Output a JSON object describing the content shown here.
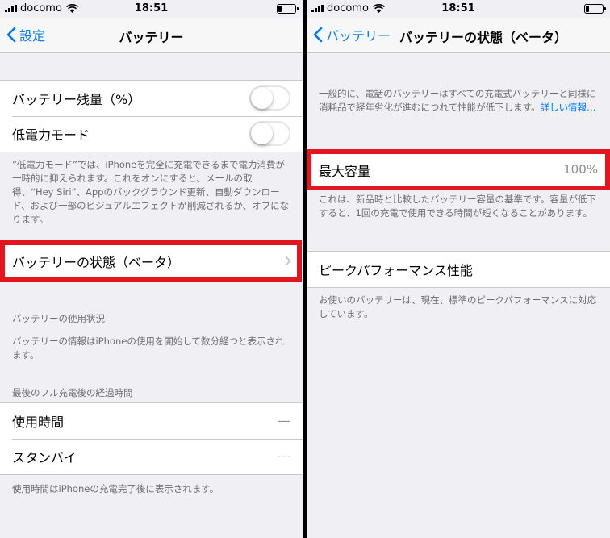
{
  "status_bar": {
    "carrier": "docomo",
    "time": "18:51"
  },
  "left": {
    "nav": {
      "back_label": "設定",
      "title": "バッテリー"
    },
    "battery_percentage": {
      "label": "バッテリー残量（%）",
      "enabled": false
    },
    "low_power_mode": {
      "label": "低電力モード",
      "enabled": false
    },
    "low_power_note": "“低電力モード”では、iPhoneを完全に充電できるまで電力消費が一時的に抑えられます。これをオンにすると、メールの取得、“Hey Siri”、Appのバックグラウンド更新、自動ダウンロード、および一部のビジュアルエフェクトが削減されるか、オフになります。",
    "battery_health_row": {
      "label": "バッテリーの状態（ベータ）"
    },
    "usage_header": "バッテリーの使用状況",
    "usage_note": "バッテリーの情報はiPhoneの使用を開始して数分経つと表示されます。",
    "since_charge_header": "最後のフル充電後の経過時間",
    "usage_row": {
      "label": "使用時間",
      "value": "—"
    },
    "standby_row": {
      "label": "スタンバイ",
      "value": "—"
    },
    "bottom_note": "使用時間はiPhoneの充電完了後に表示されます。"
  },
  "right": {
    "nav": {
      "back_label": "バッテリー",
      "title": "バッテリーの状態（ベータ）"
    },
    "intro_text": "一般的に、電話のバッテリーはすべての充電式バッテリーと同様に消耗品で経年劣化が進むにつれて性能が低下します。",
    "intro_link": "詳しい情報…",
    "max_capacity": {
      "label": "最大容量",
      "value": "100%"
    },
    "capacity_note": "これは、新品時と比較したバッテリー容量の基準です。容量が低下すると、1回の充電で使用できる時間が短くなることがあります。",
    "peak_performance": {
      "label": "ピークパフォーマンス性能"
    },
    "peak_note": "お使いのバッテリーは、現在、標準のピークパフォーマンスに対応しています。"
  },
  "colors": {
    "accent": "#007aff",
    "highlight": "#e3151f",
    "background": "#efeff4"
  }
}
